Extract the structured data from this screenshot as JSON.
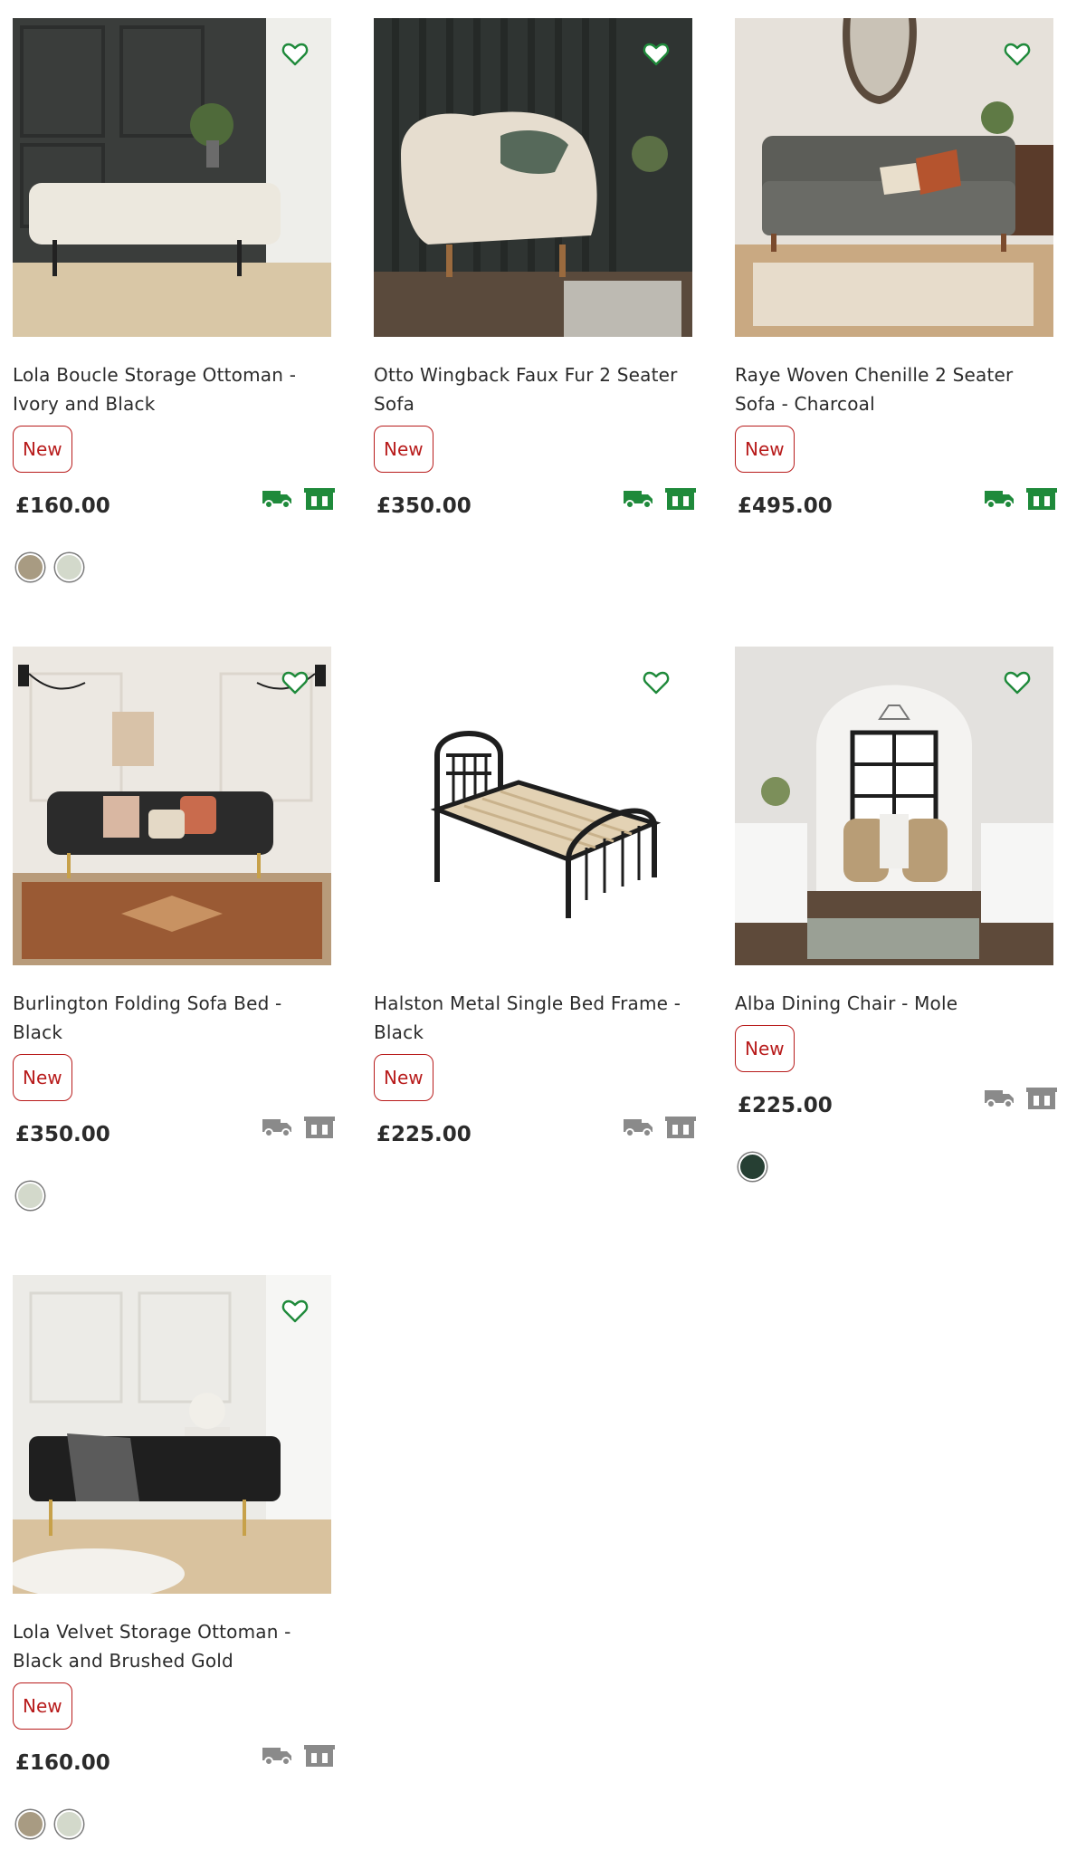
{
  "colors": {
    "accent_green": "#1f8a3b",
    "badge_red": "#b81c1c",
    "icon_grey": "#8a8a8a"
  },
  "products": [
    {
      "name": "Lola Boucle Storage Ottoman - Ivory and Black",
      "badge": "New",
      "price": "£160.00",
      "service_icons": [
        "delivery-truck-icon",
        "collect-store-icon"
      ],
      "service_color": "#1f8a3b",
      "swatches": [
        "#a89b82",
        "#d3d9cb"
      ]
    },
    {
      "name": "Otto Wingback Faux Fur 2 Seater Sofa",
      "badge": "New",
      "price": "£350.00",
      "service_icons": [
        "delivery-truck-icon",
        "collect-store-icon"
      ],
      "service_color": "#1f8a3b",
      "swatches": []
    },
    {
      "name": "Raye Woven Chenille 2 Seater Sofa - Charcoal",
      "badge": "New",
      "price": "£495.00",
      "service_icons": [
        "delivery-truck-icon",
        "collect-store-icon"
      ],
      "service_color": "#1f8a3b",
      "swatches": []
    },
    {
      "name": "Burlington Folding Sofa Bed - Black",
      "badge": "New",
      "price": "£350.00",
      "service_icons": [
        "delivery-truck-icon",
        "collect-store-icon"
      ],
      "service_color": "#8a8a8a",
      "swatches": [
        "#d3d9cb"
      ]
    },
    {
      "name": "Halston Metal Single Bed Frame - Black",
      "badge": "New",
      "price": "£225.00",
      "service_icons": [
        "delivery-truck-icon",
        "collect-store-icon"
      ],
      "service_color": "#8a8a8a",
      "swatches": []
    },
    {
      "name": "Alba Dining Chair - Mole",
      "badge": "New",
      "price": "£225.00",
      "service_icons": [
        "delivery-truck-icon",
        "collect-store-icon"
      ],
      "service_color": "#8a8a8a",
      "swatches": [
        "#263f33"
      ]
    },
    {
      "name": "Lola Velvet Storage Ottoman - Black and Brushed Gold",
      "badge": "New",
      "price": "£160.00",
      "service_icons": [
        "delivery-truck-icon",
        "collect-store-icon"
      ],
      "service_color": "#8a8a8a",
      "swatches": [
        "#a89b82",
        "#d3d9cb"
      ]
    }
  ]
}
